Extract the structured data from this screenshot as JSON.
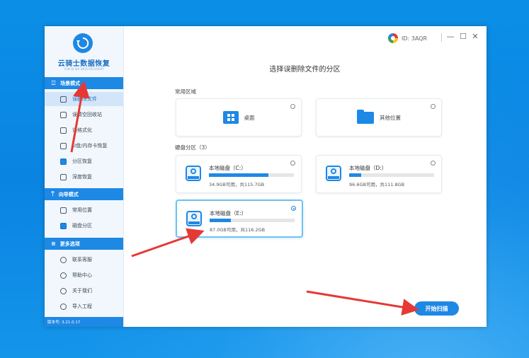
{
  "app": {
    "brand_title": "云骑士数据恢复",
    "brand_subtitle": "YUN QI SHI DATA RECOVERY",
    "id_text": "ID: 3AQR",
    "version": "版本号: 3.21.0.17"
  },
  "window_controls": {
    "minimize": "—",
    "maximize": "☐",
    "close": "✕"
  },
  "sidebar": {
    "sections": [
      {
        "title": "场景模式",
        "items": [
          {
            "label": "误删除文件",
            "active": true
          },
          {
            "label": "误清空回收站"
          },
          {
            "label": "误格式化"
          },
          {
            "label": "U盘/内存卡恢复"
          },
          {
            "label": "分区恢复"
          },
          {
            "label": "深度恢复"
          }
        ]
      },
      {
        "title": "向导模式",
        "items": [
          {
            "label": "常用位置"
          },
          {
            "label": "磁盘分区"
          }
        ]
      },
      {
        "title": "更多选项",
        "items": [
          {
            "label": "联系客服"
          },
          {
            "label": "帮助中心"
          },
          {
            "label": "关于我们"
          },
          {
            "label": "导入工程"
          }
        ]
      }
    ]
  },
  "main": {
    "title": "选择误删除文件的分区",
    "common_label": "常用区域",
    "common": [
      {
        "label": "桌面",
        "icon": "windows-logo-icon"
      },
      {
        "label": "其他位置",
        "icon": "folder-icon"
      }
    ],
    "disks_label": "硬盘分区（3）",
    "disks": [
      {
        "name": "本地磁盘（C:）",
        "info": "34.9GB可用，共115.7GB",
        "used_fraction": 0.7,
        "selected": false
      },
      {
        "name": "本地磁盘（D:）",
        "info": "96.6GB可用，共111.8GB",
        "used_fraction": 0.14,
        "selected": false
      },
      {
        "name": "本地磁盘（E:）",
        "info": "87.0GB可用，共116.2GB",
        "used_fraction": 0.25,
        "selected": true
      }
    ],
    "start_button": "开始扫描"
  },
  "colors": {
    "accent": "#1e88e5",
    "annotation_arrow": "#e53935",
    "desktop_bg": "#0a84e2"
  }
}
